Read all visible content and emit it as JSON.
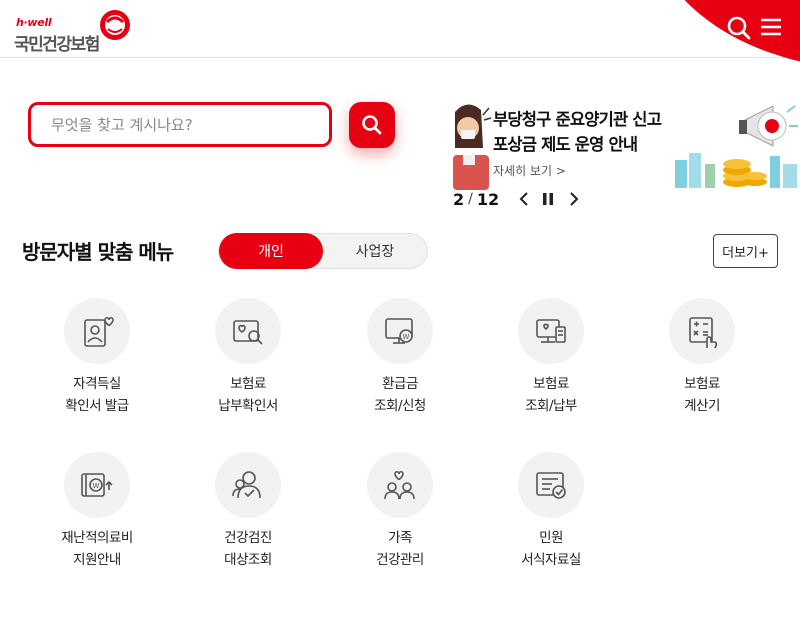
{
  "header": {
    "logo_small": "h·well",
    "logo_main": "국민건강보험",
    "search_icon": "search-icon",
    "menu_icon": "hamburger-menu-icon",
    "accent_color": "#e60012"
  },
  "search": {
    "placeholder": "무엇을 찾고 계시나요?",
    "button_icon": "search-icon"
  },
  "banner": {
    "title_line1": "부당청구 준요양기관 신고",
    "title_line2": "포상금 제도 운영 안내",
    "more_label": "자세히 보기 >",
    "pager_current": "2",
    "pager_separator": "/",
    "pager_total": "12"
  },
  "section": {
    "title": "방문자별 맞춤 메뉴",
    "tab_personal": "개인",
    "tab_business": "사업장",
    "more_label": "더보기+"
  },
  "menu_items": [
    {
      "label": "자격득실\n확인서 발급",
      "icon": "id-card-heart-icon"
    },
    {
      "label": "보험료\n납부확인서",
      "icon": "document-search-icon"
    },
    {
      "label": "환급금\n조회/신청",
      "icon": "monitor-won-icon"
    },
    {
      "label": "보험료\n조회/납부",
      "icon": "computer-document-icon"
    },
    {
      "label": "보험료\n계산기",
      "icon": "calculator-hand-icon"
    },
    {
      "label": "재난적의료비\n지원안내",
      "icon": "won-support-icon"
    },
    {
      "label": "건강검진\n대상조회",
      "icon": "people-check-icon"
    },
    {
      "label": "가족\n건강관리",
      "icon": "family-heart-icon"
    },
    {
      "label": "민원\n서식자료실",
      "icon": "form-document-icon"
    }
  ]
}
